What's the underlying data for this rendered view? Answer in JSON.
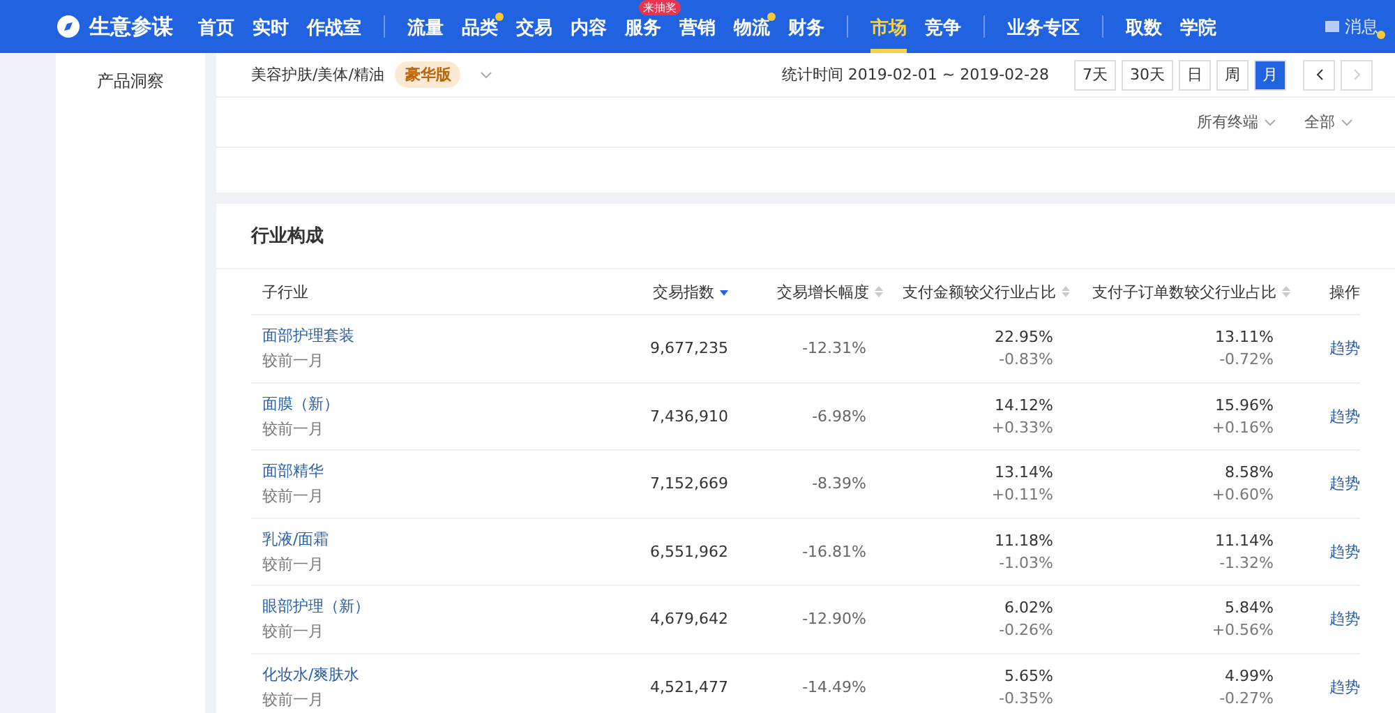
{
  "topbar": {
    "brand": "生意参谋",
    "nav_groups": [
      [
        {
          "label": "首页",
          "selected": false,
          "dot": false
        },
        {
          "label": "实时",
          "selected": false,
          "dot": false
        },
        {
          "label": "作战室",
          "selected": false,
          "dot": false
        }
      ],
      [
        {
          "label": "流量",
          "selected": false,
          "dot": false
        },
        {
          "label": "品类",
          "selected": false,
          "dot": true
        },
        {
          "label": "交易",
          "selected": false,
          "dot": false
        },
        {
          "label": "内容",
          "selected": false,
          "dot": false
        },
        {
          "label": "服务",
          "selected": false,
          "dot": false,
          "badge": "来抽奖"
        },
        {
          "label": "营销",
          "selected": false,
          "dot": false
        },
        {
          "label": "物流",
          "selected": false,
          "dot": true
        },
        {
          "label": "财务",
          "selected": false,
          "dot": false
        }
      ],
      [
        {
          "label": "市场",
          "selected": true,
          "dot": false
        },
        {
          "label": "竞争",
          "selected": false,
          "dot": false
        }
      ],
      [
        {
          "label": "业务专区",
          "selected": false,
          "dot": false
        }
      ],
      [
        {
          "label": "取数",
          "selected": false,
          "dot": false
        },
        {
          "label": "学院",
          "selected": false,
          "dot": false
        }
      ]
    ],
    "messages": {
      "label": "消息",
      "dot": true
    }
  },
  "sidebar": {
    "items": [
      {
        "label": "产品洞察"
      }
    ]
  },
  "filter": {
    "category": "美容护肤/美体/精油",
    "edition_badge": "豪华版",
    "period_label": "统计时间 2019-02-01 ~ 2019-02-28",
    "periods": [
      {
        "label": "7天",
        "selected": false
      },
      {
        "label": "30天",
        "selected": false
      },
      {
        "label": "日",
        "selected": false
      },
      {
        "label": "周",
        "selected": false
      },
      {
        "label": "月",
        "selected": true
      }
    ],
    "prev": {
      "disabled": false
    },
    "next": {
      "disabled": true
    },
    "dropdowns": [
      "所有终端",
      "全部"
    ]
  },
  "industry": {
    "title": "行业构成",
    "columns": [
      {
        "label": "子行业",
        "kind": "plain"
      },
      {
        "label": "交易指数",
        "kind": "sortable",
        "sorted": true
      },
      {
        "label": "交易增长幅度",
        "kind": "sortable",
        "sorted": false
      },
      {
        "label": "支付金额较父行业占比",
        "kind": "sortable",
        "sorted": false
      },
      {
        "label": "支付子订单数较父行业占比",
        "kind": "sortable",
        "sorted": false
      },
      {
        "label": "操作",
        "kind": "plain"
      }
    ],
    "rows": [
      {
        "name": "面部护理套装",
        "compare": "较前一月",
        "index": "9,677,235",
        "growth": "-12.31%",
        "pay_share": "22.95%",
        "pay_change": "-0.83%",
        "order_share": "13.11%",
        "order_change": "-0.72%",
        "action": "趋势"
      },
      {
        "name": "面膜（新）",
        "compare": "较前一月",
        "index": "7,436,910",
        "growth": "-6.98%",
        "pay_share": "14.12%",
        "pay_change": "+0.33%",
        "order_share": "15.96%",
        "order_change": "+0.16%",
        "action": "趋势"
      },
      {
        "name": "面部精华",
        "compare": "较前一月",
        "index": "7,152,669",
        "growth": "-8.39%",
        "pay_share": "13.14%",
        "pay_change": "+0.11%",
        "order_share": "8.58%",
        "order_change": "+0.60%",
        "action": "趋势"
      },
      {
        "name": "乳液/面霜",
        "compare": "较前一月",
        "index": "6,551,962",
        "growth": "-16.81%",
        "pay_share": "11.18%",
        "pay_change": "-1.03%",
        "order_share": "11.14%",
        "order_change": "-1.32%",
        "action": "趋势"
      },
      {
        "name": "眼部护理（新）",
        "compare": "较前一月",
        "index": "4,679,642",
        "growth": "-12.90%",
        "pay_share": "6.02%",
        "pay_change": "-0.26%",
        "order_share": "5.84%",
        "order_change": "+0.56%",
        "action": "趋势"
      },
      {
        "name": "化妆水/爽肤水",
        "compare": "较前一月",
        "index": "4,521,477",
        "growth": "-14.49%",
        "pay_share": "5.65%",
        "pay_change": "-0.35%",
        "order_share": "4.99%",
        "order_change": "-0.27%",
        "action": "趋势"
      }
    ]
  }
}
